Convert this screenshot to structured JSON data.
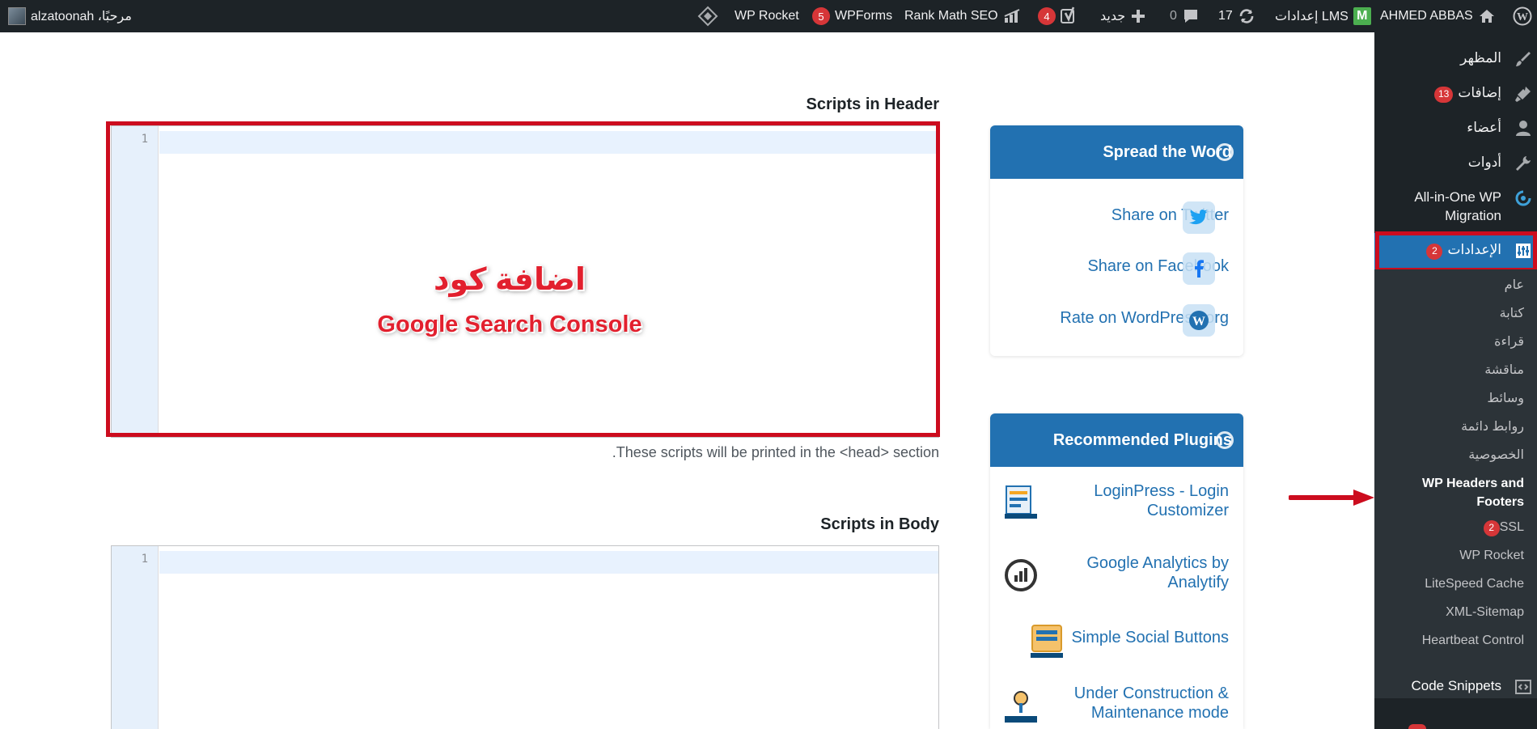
{
  "adminbar": {
    "site_name": "AHMED ABBAS",
    "lms": "إعدادات LMS",
    "updates": "17",
    "comments": "0",
    "new": "جديد",
    "yoast_count": "4",
    "rankmath": "Rank Math SEO",
    "wpforms": "WPForms",
    "wpforms_count": "5",
    "wprocket": "WP Rocket",
    "greeting": "مرحبًا، alzatoonah"
  },
  "sidebar": {
    "items": [
      {
        "label": "المظهر",
        "icon": "paintbrush-icon"
      },
      {
        "label": "إضافات",
        "badge": "13",
        "icon": "plugin-icon"
      },
      {
        "label": "أعضاء",
        "icon": "user-icon"
      },
      {
        "label": "أدوات",
        "icon": "wrench-icon"
      },
      {
        "label": "All-in-One WP Migration",
        "icon": "migration-icon"
      },
      {
        "label": "الإعدادات",
        "badge": "2",
        "icon": "settings-icon"
      }
    ],
    "submenu": [
      "عام",
      "كتابة",
      "قراءة",
      "مناقشة",
      "وسائط",
      "روابط دائمة",
      "الخصوصية",
      "WP Headers and Footers",
      "SSL",
      "WP Rocket",
      "LiteSpeed Cache",
      "XML-Sitemap",
      "Heartbeat Control"
    ],
    "ssl_badge": "2",
    "code_snippets": "Code Snippets"
  },
  "main": {
    "header_title": "Scripts in Header",
    "header_line": "1",
    "overlay_ar": "اضافة كود",
    "overlay_en": "Google Search Console",
    "header_desc": "These scripts will be printed in the <head> section.",
    "body_title": "Scripts in Body",
    "body_line": "1"
  },
  "spread": {
    "title": "Spread the Word",
    "twitter": "Share on Twitter",
    "facebook": "Share on Facebook",
    "rate": "Rate on WordPress.org"
  },
  "recommended": {
    "title": "Recommended Plugins",
    "plugins": [
      "LoginPress - Login Customizer",
      "Google Analytics by Analytify",
      "Simple Social Buttons",
      "Under Construction & Maintenance mode"
    ]
  },
  "colors": {
    "accent": "#2271b1",
    "highlight": "#cc0c1e",
    "adminbar": "#1d2327"
  }
}
